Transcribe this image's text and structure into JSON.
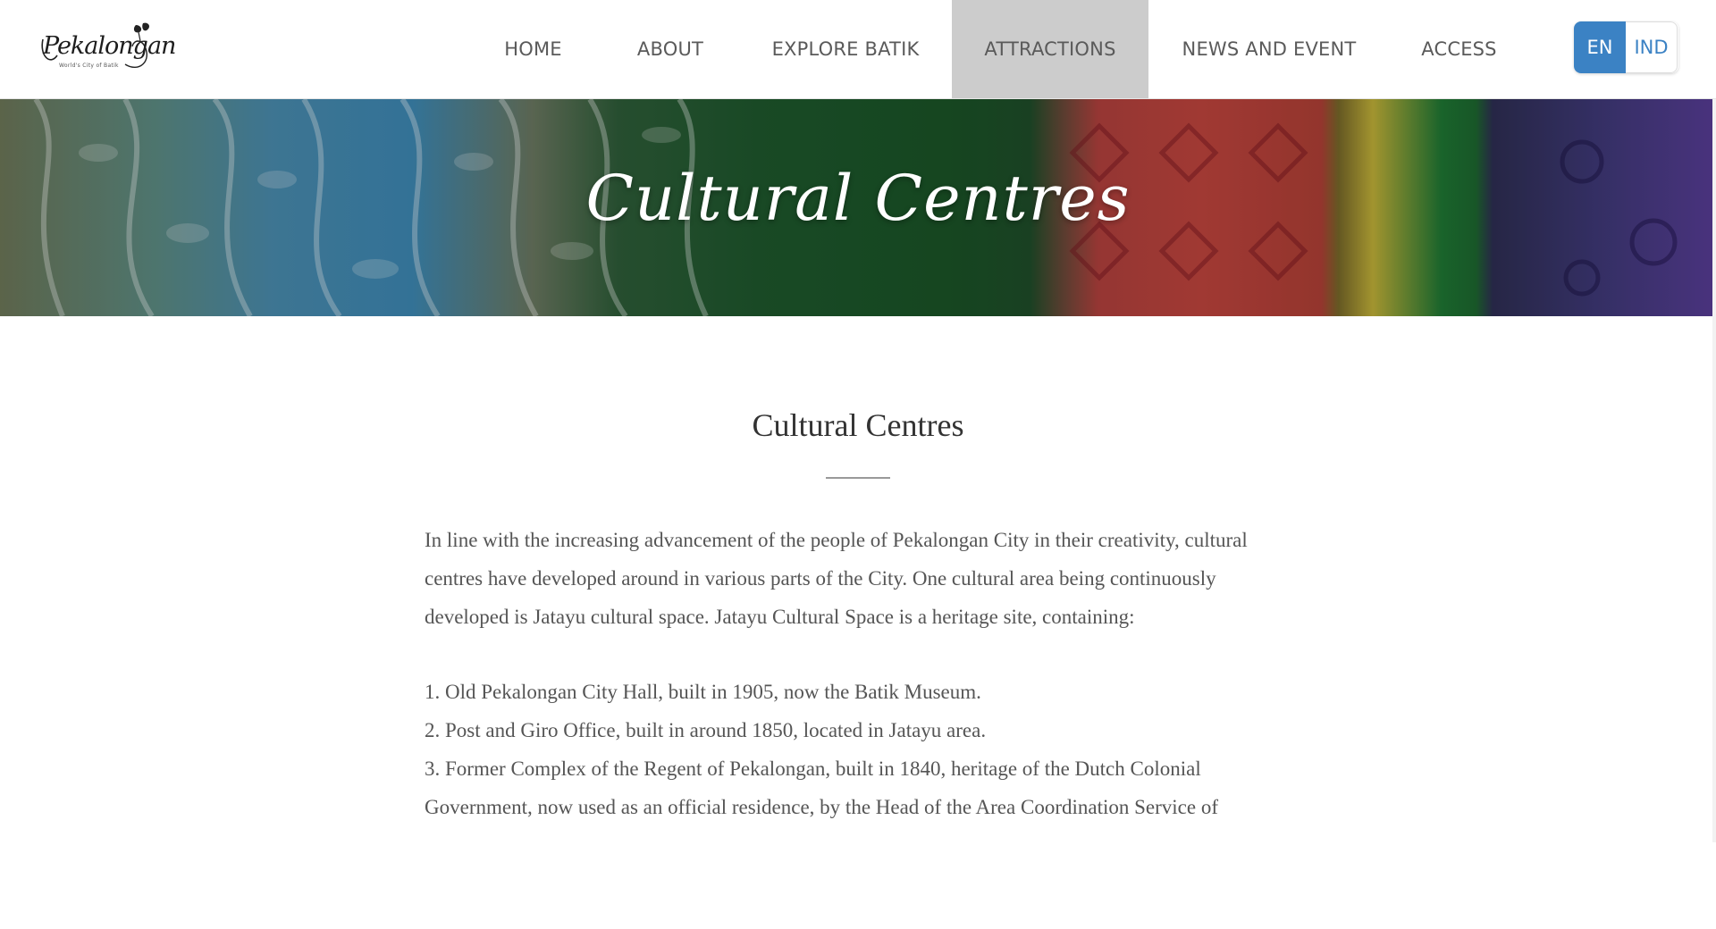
{
  "header": {
    "logo": {
      "text": "Pekalongan",
      "tagline": "World's City of Batik"
    },
    "nav": [
      {
        "label": "HOME"
      },
      {
        "label": "ABOUT"
      },
      {
        "label": "EXPLORE BATIK"
      },
      {
        "label": "ATTRACTIONS",
        "active": true
      },
      {
        "label": "NEWS AND EVENT"
      },
      {
        "label": "ACCESS"
      }
    ],
    "language": {
      "options": [
        "EN",
        "IND"
      ],
      "selected": "EN"
    }
  },
  "banner": {
    "title": "Cultural Centres"
  },
  "main": {
    "title": "Cultural Centres",
    "intro": "In line with the increasing advancement of the people of Pekalongan City in their creativity, cultural centres have developed around in various parts of the City. One cultural area being continuously developed is Jatayu cultural space. Jatayu Cultural Space is a heritage site, containing:",
    "items": [
      "1. Old Pekalongan City Hall, built in 1905, now the Batik Museum.",
      "2. Post and Giro Office, built in around 1850, located in Jatayu area.",
      "3. Former Complex of the Regent of Pekalongan, built in 1840, heritage of the Dutch Colonial Government, now used as an official residence, by the Head of the Area Coordination Service of"
    ]
  },
  "colors": {
    "accent": "#3b82c4",
    "nav_active_bg": "#cccccc",
    "body_text": "#555555"
  }
}
